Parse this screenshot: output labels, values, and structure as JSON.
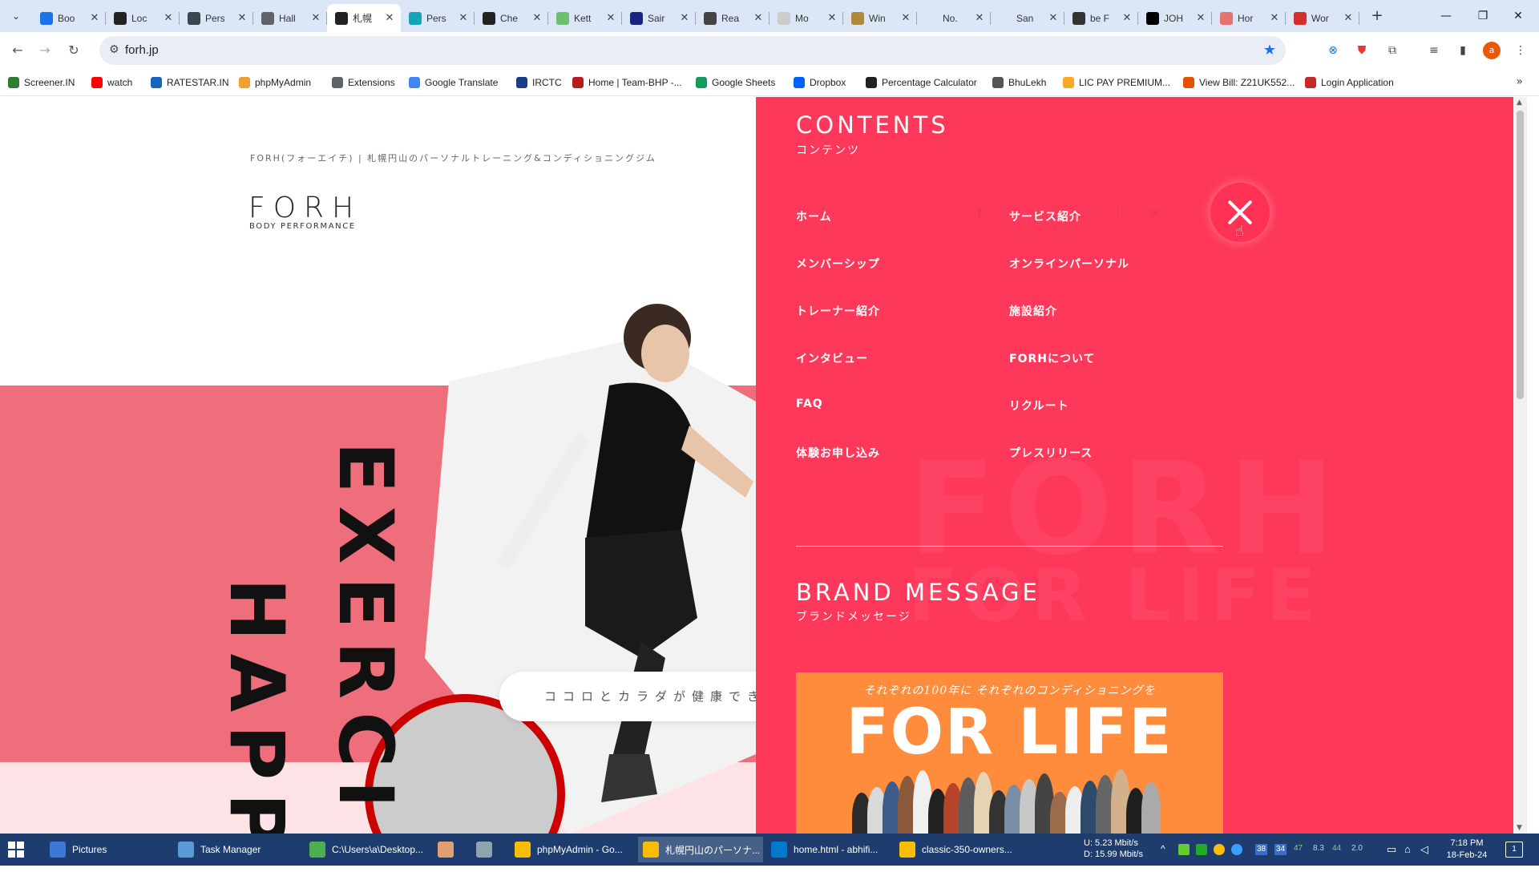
{
  "tabs": [
    {
      "title": "Boo",
      "fav_color": "#1a73e8",
      "icon": "star-icon"
    },
    {
      "title": "Loc",
      "fav_color": "#222222",
      "icon": "brand-icon"
    },
    {
      "title": "Pers",
      "fav_color": "#37474f",
      "icon": "globe-icon"
    },
    {
      "title": "Hall",
      "fav_color": "#5f6368",
      "icon": "brand-icon"
    },
    {
      "title": "札幌",
      "fav_color": "#222222",
      "icon": "h-icon",
      "active": true
    },
    {
      "title": "Pers",
      "fav_color": "#14a3b8",
      "icon": "brand-icon"
    },
    {
      "title": "Che",
      "fav_color": "#222222",
      "icon": "brand-icon"
    },
    {
      "title": "Kett",
      "fav_color": "#6cc070",
      "icon": "brand-icon"
    },
    {
      "title": "Sair",
      "fav_color": "#1a237e",
      "icon": "brand-icon"
    },
    {
      "title": "Rea",
      "fav_color": "#444444",
      "icon": "cube-icon"
    },
    {
      "title": "Mo",
      "fav_color": "#cccccc",
      "icon": "globe-icon"
    },
    {
      "title": "Win",
      "fav_color": "#b08a3a",
      "icon": "brand-icon"
    },
    {
      "title": "No.",
      "fav_color": "#dbe6f7",
      "icon": "blank-icon"
    },
    {
      "title": "San",
      "fav_color": "#dbe6f7",
      "icon": "blank-icon"
    },
    {
      "title": "be F",
      "fav_color": "#333333",
      "icon": "brand-icon"
    },
    {
      "title": "JOH",
      "fav_color": "#000000",
      "icon": "jr-icon"
    },
    {
      "title": "Hor",
      "fav_color": "#e57373",
      "icon": "brand-icon"
    },
    {
      "title": "Wor",
      "fav_color": "#d32f2f",
      "icon": "brand-icon"
    }
  ],
  "address": {
    "url": "forh.jp"
  },
  "bookmarks": [
    {
      "label": "Screener.IN",
      "color": "#2e7d32"
    },
    {
      "label": "watch",
      "color": "#ff0000"
    },
    {
      "label": "RATESTAR.IN",
      "color": "#1565c0"
    },
    {
      "label": "phpMyAdmin",
      "color": "#f0a030"
    },
    {
      "label": "Extensions",
      "color": "#5f6368"
    },
    {
      "label": "Google Translate",
      "color": "#4285f4"
    },
    {
      "label": "IRCTC",
      "color": "#1a3c8a"
    },
    {
      "label": "Home | Team-BHP -...",
      "color": "#b71c1c"
    },
    {
      "label": "Google Sheets",
      "color": "#0f9d58"
    },
    {
      "label": "Dropbox",
      "color": "#0061ff"
    },
    {
      "label": "Percentage Calculator",
      "color": "#222222"
    },
    {
      "label": "BhuLekh",
      "color": "#555555"
    },
    {
      "label": "LIC PAY PREMIUM...",
      "color": "#f9a825"
    },
    {
      "label": "View Bill: Z21UK552...",
      "color": "#e65100"
    },
    {
      "label": "Login Application",
      "color": "#c62828"
    }
  ],
  "page": {
    "tagline": "FORH(フォーエイチ) | 札幌円山のパーソナルトレーニング&コンディショニングジム",
    "logo": "FORH",
    "logo_sub": "BODY PERFORMANCE",
    "vertical_1": "EXERCI",
    "vertical_2": "HAPP",
    "pill_text": "ココロとカラダが健康でき"
  },
  "menu": {
    "contents_title": "CONTENTS",
    "contents_sub": "コンテンツ",
    "items_left": [
      "ホーム",
      "メンバーシップ",
      "トレーナー紹介",
      "インタビュー",
      "FAQ",
      "体験お申し込み"
    ],
    "items_right": [
      "サービス紹介",
      "オンラインパーソナル",
      "施設紹介",
      "FORHについて",
      "リクルート",
      "プレスリリース"
    ],
    "brand_title": "BRAND MESSAGE",
    "brand_sub": "ブランドメッセージ",
    "banner_sub": "それぞれの100年に それぞれのコンディショニングを",
    "banner_title": "FOR LIFE",
    "bg_ghost": "FORH",
    "bg_ghost2": "FOR LIFE",
    "accent": "#fe385b"
  },
  "taskbar": {
    "items": [
      {
        "label": "Pictures",
        "color": "#3c78d8"
      },
      {
        "label": "Task Manager",
        "color": "#5b9bd5"
      },
      {
        "label": "C:\\Users\\a\\Desktop...",
        "color": "#4caf50"
      },
      {
        "label": "",
        "color": "#e0a070"
      },
      {
        "label": "",
        "color": "#90a4ae"
      },
      {
        "label": "phpMyAdmin - Go...",
        "color": "#fbbc05"
      },
      {
        "label": "札幌円山のパーソナ...",
        "color": "#fbbc05",
        "active": true
      },
      {
        "label": "home.html - abhifi...",
        "color": "#007acc"
      },
      {
        "label": "classic-350-owners...",
        "color": "#fbbc05"
      }
    ],
    "net_up": "U: 5.23 Mbit/s",
    "net_down": "D: 15.99 Mbit/s",
    "tray_nums": [
      "38",
      "34",
      "47",
      "8.3",
      "44",
      "2.0"
    ],
    "time": "7:18 PM",
    "date": "18-Feb-24",
    "notif": "1"
  }
}
